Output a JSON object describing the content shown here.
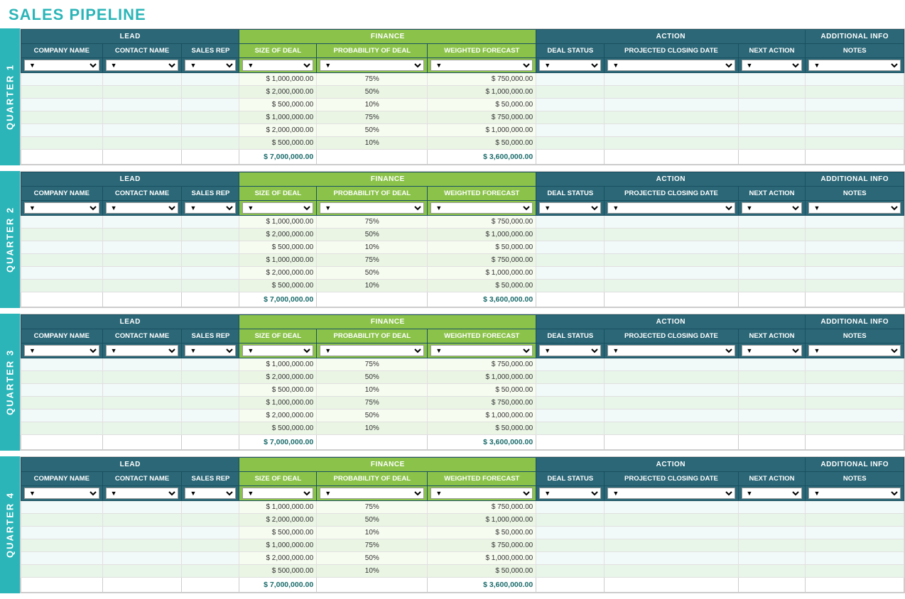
{
  "title": "SALES PIPELINE",
  "quarters": [
    {
      "label": "QUARTER 1"
    },
    {
      "label": "QUARTER 2"
    },
    {
      "label": "QUARTER 3"
    },
    {
      "label": "QUARTER 4"
    }
  ],
  "section_headers": {
    "lead": "LEAD",
    "finance": "FINANCE",
    "action": "ACTION",
    "additional_info": "ADDITIONAL INFO"
  },
  "col_headers": {
    "company_name": "COMPANY NAME",
    "contact_name": "CONTACT NAME",
    "sales_rep": "SALES REP",
    "size_of_deal": "SIZE OF DEAL",
    "probability_of_deal": "PROBABILITY OF DEAL",
    "weighted_forecast": "WEIGHTED FORECAST",
    "deal_status": "DEAL STATUS",
    "projected_closing_date": "PROJECTED CLOSING DATE",
    "next_action": "NEXT ACTION",
    "notes": "NOTES"
  },
  "data_rows": [
    {
      "size": "$ 1,000,000.00",
      "prob": "75%",
      "weighted": "$ 750,000.00"
    },
    {
      "size": "$ 2,000,000.00",
      "prob": "50%",
      "weighted": "$ 1,000,000.00"
    },
    {
      "size": "$ 500,000.00",
      "prob": "10%",
      "weighted": "$ 50,000.00"
    },
    {
      "size": "$ 1,000,000.00",
      "prob": "75%",
      "weighted": "$ 750,000.00"
    },
    {
      "size": "$ 2,000,000.00",
      "prob": "50%",
      "weighted": "$ 1,000,000.00"
    },
    {
      "size": "$ 500,000.00",
      "prob": "10%",
      "weighted": "$ 50,000.00"
    }
  ],
  "totals": {
    "size": "$ 7,000,000.00",
    "weighted": "$ 3,600,000.00"
  },
  "dropdown_symbol": "▼"
}
